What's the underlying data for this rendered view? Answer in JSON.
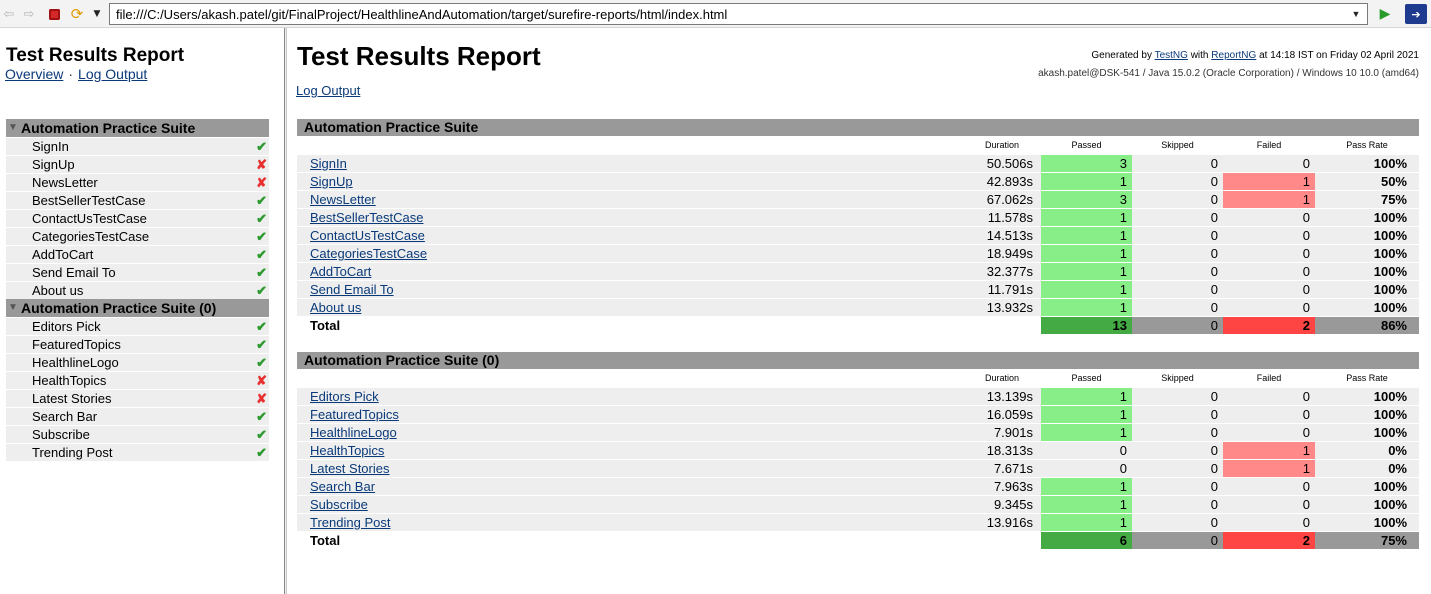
{
  "browser": {
    "url": "file:///C:/Users/akash.patel/git/FinalProject/HealthlineAndAutomation/target/surefire-reports/html/index.html"
  },
  "nav": {
    "title": "Test Results Report",
    "overview_link": "Overview",
    "separator": "·",
    "log_link": "Log Output",
    "suites": [
      {
        "name": "Automation Practice Suite",
        "tests": [
          {
            "name": "SignIn",
            "status": "pass"
          },
          {
            "name": "SignUp",
            "status": "fail"
          },
          {
            "name": "NewsLetter",
            "status": "fail"
          },
          {
            "name": "BestSellerTestCase",
            "status": "pass"
          },
          {
            "name": "ContactUsTestCase",
            "status": "pass"
          },
          {
            "name": "CategoriesTestCase",
            "status": "pass"
          },
          {
            "name": "AddToCart",
            "status": "pass"
          },
          {
            "name": "Send Email To",
            "status": "pass"
          },
          {
            "name": "About us",
            "status": "pass"
          }
        ]
      },
      {
        "name": "Automation Practice Suite (0)",
        "tests": [
          {
            "name": "Editors Pick",
            "status": "pass"
          },
          {
            "name": "FeaturedTopics",
            "status": "pass"
          },
          {
            "name": "HealthlineLogo",
            "status": "pass"
          },
          {
            "name": "HealthTopics",
            "status": "fail"
          },
          {
            "name": "Latest Stories",
            "status": "fail"
          },
          {
            "name": "Search Bar",
            "status": "pass"
          },
          {
            "name": "Subscribe",
            "status": "pass"
          },
          {
            "name": "Trending Post",
            "status": "pass"
          }
        ]
      }
    ]
  },
  "report": {
    "title": "Test Results Report",
    "generated": {
      "prefix": "Generated by",
      "testng": "TestNG",
      "with": "with",
      "reportng": "ReportNG",
      "suffix": "at 14:18 IST on Friday 02 April 2021"
    },
    "environment": "akash.patel@DSK-541 / Java 15.0.2 (Oracle Corporation) / Windows 10 10.0 (amd64)",
    "log_link": "Log Output",
    "columns": {
      "duration": "Duration",
      "passed": "Passed",
      "skipped": "Skipped",
      "failed": "Failed",
      "pass_rate": "Pass Rate"
    },
    "total_label": "Total",
    "suites": [
      {
        "name": "Automation Practice Suite",
        "rows": [
          {
            "name": "SignIn",
            "duration": "50.506s",
            "passed": "3",
            "skipped": "0",
            "failed": "0",
            "rate": "100%"
          },
          {
            "name": "SignUp",
            "duration": "42.893s",
            "passed": "1",
            "skipped": "0",
            "failed": "1",
            "rate": "50%"
          },
          {
            "name": "NewsLetter",
            "duration": "67.062s",
            "passed": "3",
            "skipped": "0",
            "failed": "1",
            "rate": "75%"
          },
          {
            "name": "BestSellerTestCase",
            "duration": "11.578s",
            "passed": "1",
            "skipped": "0",
            "failed": "0",
            "rate": "100%"
          },
          {
            "name": "ContactUsTestCase",
            "duration": "14.513s",
            "passed": "1",
            "skipped": "0",
            "failed": "0",
            "rate": "100%"
          },
          {
            "name": "CategoriesTestCase",
            "duration": "18.949s",
            "passed": "1",
            "skipped": "0",
            "failed": "0",
            "rate": "100%"
          },
          {
            "name": "AddToCart",
            "duration": "32.377s",
            "passed": "1",
            "skipped": "0",
            "failed": "0",
            "rate": "100%"
          },
          {
            "name": "Send Email To",
            "duration": "11.791s",
            "passed": "1",
            "skipped": "0",
            "failed": "0",
            "rate": "100%"
          },
          {
            "name": "About us",
            "duration": "13.932s",
            "passed": "1",
            "skipped": "0",
            "failed": "0",
            "rate": "100%"
          }
        ],
        "total": {
          "passed": "13",
          "skipped": "0",
          "failed": "2",
          "rate": "86%"
        }
      },
      {
        "name": "Automation Practice Suite (0)",
        "rows": [
          {
            "name": "Editors Pick",
            "duration": "13.139s",
            "passed": "1",
            "skipped": "0",
            "failed": "0",
            "rate": "100%"
          },
          {
            "name": "FeaturedTopics",
            "duration": "16.059s",
            "passed": "1",
            "skipped": "0",
            "failed": "0",
            "rate": "100%"
          },
          {
            "name": "HealthlineLogo",
            "duration": "7.901s",
            "passed": "1",
            "skipped": "0",
            "failed": "0",
            "rate": "100%"
          },
          {
            "name": "HealthTopics",
            "duration": "18.313s",
            "passed": "0",
            "skipped": "0",
            "failed": "1",
            "rate": "0%"
          },
          {
            "name": "Latest Stories",
            "duration": "7.671s",
            "passed": "0",
            "skipped": "0",
            "failed": "1",
            "rate": "0%"
          },
          {
            "name": "Search Bar",
            "duration": "7.963s",
            "passed": "1",
            "skipped": "0",
            "failed": "0",
            "rate": "100%"
          },
          {
            "name": "Subscribe",
            "duration": "9.345s",
            "passed": "1",
            "skipped": "0",
            "failed": "0",
            "rate": "100%"
          },
          {
            "name": "Trending Post",
            "duration": "13.916s",
            "passed": "1",
            "skipped": "0",
            "failed": "0",
            "rate": "100%"
          }
        ],
        "total": {
          "passed": "6",
          "skipped": "0",
          "failed": "2",
          "rate": "75%"
        }
      }
    ]
  },
  "colors": {
    "pass_cell": "#88ee88",
    "fail_cell": "#ff8888",
    "total_pass": "#44aa44",
    "total_fail": "#ff4444",
    "header_grey": "#999999"
  }
}
